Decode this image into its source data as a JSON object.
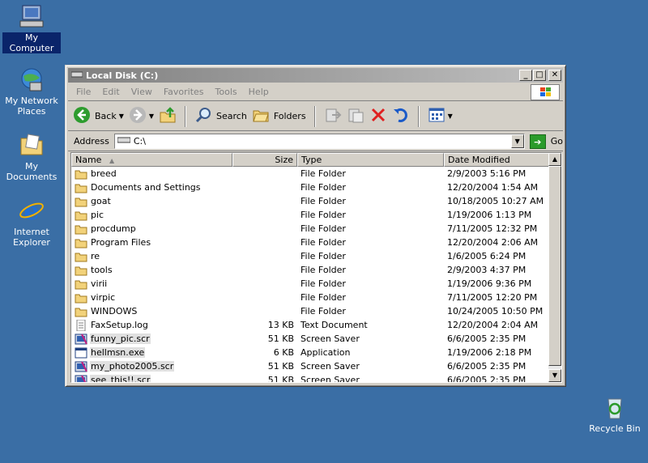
{
  "desktop": {
    "icons": [
      {
        "label": "My Computer",
        "icon": "my-computer-icon"
      },
      {
        "label": "My Network Places",
        "icon": "network-places-icon"
      },
      {
        "label": "My Documents",
        "icon": "my-documents-icon"
      },
      {
        "label": "Internet Explorer",
        "icon": "internet-explorer-icon"
      },
      {
        "label": "Recycle Bin",
        "icon": "recycle-bin-icon"
      }
    ]
  },
  "window": {
    "title": "Local Disk (C:)",
    "controls": {
      "minimize": "_",
      "maximize": "□",
      "close": "✕"
    },
    "menu": [
      "File",
      "Edit",
      "View",
      "Favorites",
      "Tools",
      "Help"
    ],
    "toolbar": {
      "back": "Back",
      "search": "Search",
      "folders": "Folders"
    },
    "address": {
      "label": "Address",
      "value": "C:\\",
      "go": "Go"
    },
    "columns": [
      "Name",
      "Size",
      "Type",
      "Date Modified"
    ],
    "files": [
      {
        "name": "breed",
        "size": "",
        "type": "File Folder",
        "date": "2/9/2003 5:16 PM",
        "kind": "folder"
      },
      {
        "name": "Documents and Settings",
        "size": "",
        "type": "File Folder",
        "date": "12/20/2004 1:54 AM",
        "kind": "folder"
      },
      {
        "name": "goat",
        "size": "",
        "type": "File Folder",
        "date": "10/18/2005 10:27 AM",
        "kind": "folder"
      },
      {
        "name": "pic",
        "size": "",
        "type": "File Folder",
        "date": "1/19/2006 1:13 PM",
        "kind": "folder"
      },
      {
        "name": "procdump",
        "size": "",
        "type": "File Folder",
        "date": "7/11/2005 12:32 PM",
        "kind": "folder"
      },
      {
        "name": "Program Files",
        "size": "",
        "type": "File Folder",
        "date": "12/20/2004 2:06 AM",
        "kind": "folder"
      },
      {
        "name": "re",
        "size": "",
        "type": "File Folder",
        "date": "1/6/2005 6:24 PM",
        "kind": "folder"
      },
      {
        "name": "tools",
        "size": "",
        "type": "File Folder",
        "date": "2/9/2003 4:37 PM",
        "kind": "folder"
      },
      {
        "name": "virii",
        "size": "",
        "type": "File Folder",
        "date": "1/19/2006 9:36 PM",
        "kind": "folder"
      },
      {
        "name": "virpic",
        "size": "",
        "type": "File Folder",
        "date": "7/11/2005 12:20 PM",
        "kind": "folder"
      },
      {
        "name": "WINDOWS",
        "size": "",
        "type": "File Folder",
        "date": "10/24/2005 10:50 PM",
        "kind": "folder"
      },
      {
        "name": "FaxSetup.log",
        "size": "13 KB",
        "type": "Text Document",
        "date": "12/20/2004 2:04 AM",
        "kind": "text"
      },
      {
        "name": "funny_pic.scr",
        "size": "51 KB",
        "type": "Screen Saver",
        "date": "6/6/2005 2:35 PM",
        "kind": "scr"
      },
      {
        "name": "hellmsn.exe",
        "size": "6 KB",
        "type": "Application",
        "date": "1/19/2006 2:18 PM",
        "kind": "exe"
      },
      {
        "name": "my_photo2005.scr",
        "size": "51 KB",
        "type": "Screen Saver",
        "date": "6/6/2005 2:35 PM",
        "kind": "scr"
      },
      {
        "name": "see_this!!.scr",
        "size": "51 KB",
        "type": "Screen Saver",
        "date": "6/6/2005 2:35 PM",
        "kind": "scr"
      }
    ]
  }
}
